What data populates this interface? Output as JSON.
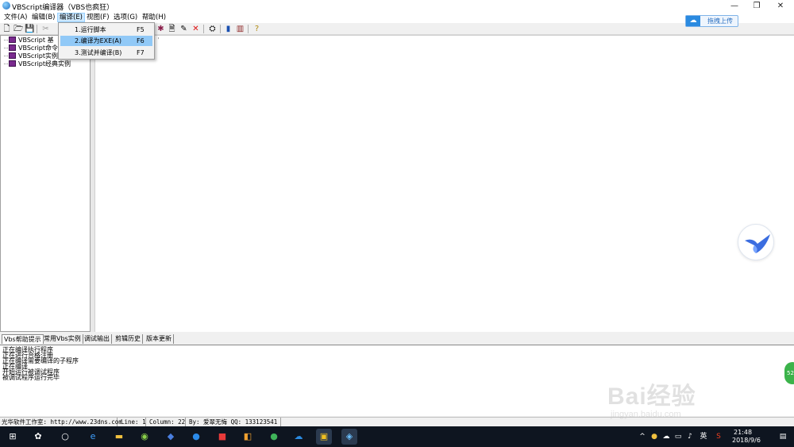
{
  "window": {
    "title": "VBScript编译器（VBS也疯狂）",
    "minimize": "—",
    "restore": "❐",
    "close": "✕"
  },
  "menu": [
    "文件(A)",
    "编辑(B)",
    "编译(E)",
    "视图(F)",
    "选项(G)",
    "帮助(H)"
  ],
  "compile_menu": [
    {
      "label": "1.运行脚本",
      "shortcut": "F5"
    },
    {
      "label": "2.编译为EXE(A)",
      "shortcut": "F6"
    },
    {
      "label": "3.测试并编译(B)",
      "shortcut": "F7"
    }
  ],
  "upload_button": {
    "label": "拖拽上传"
  },
  "tree": [
    {
      "label": "VBScript 基"
    },
    {
      "label": "VBScript命令"
    },
    {
      "label": "VBScript实例"
    },
    {
      "label": "VBScript经典实例"
    }
  ],
  "editor": {
    "text": "'"
  },
  "tabs": [
    "Vbs帮助提示",
    "常用Vbs实例",
    "调试输出",
    "剪辑历史",
    "版本更新"
  ],
  "output_lines": [
    "正在编译执行程序",
    "正在进行合格注册",
    "正在编译需要编译的子程序",
    "正在编译",
    "开始运行被调试程序",
    "被调试程序运行完毕"
  ],
  "status": {
    "studio": "光华软件工作室: http://www.23dns.com",
    "line": "Line: 1",
    "column": "Column: 22",
    "author": "By: 爱翠无悔 QQ: 133123541"
  },
  "watermark": {
    "main": "Bai经验",
    "sub": "jingyan.baidu.com"
  },
  "green_badge": "52",
  "taskbar": {
    "tray_lang": "英",
    "time": "21:48",
    "date": "2018/9/6"
  }
}
